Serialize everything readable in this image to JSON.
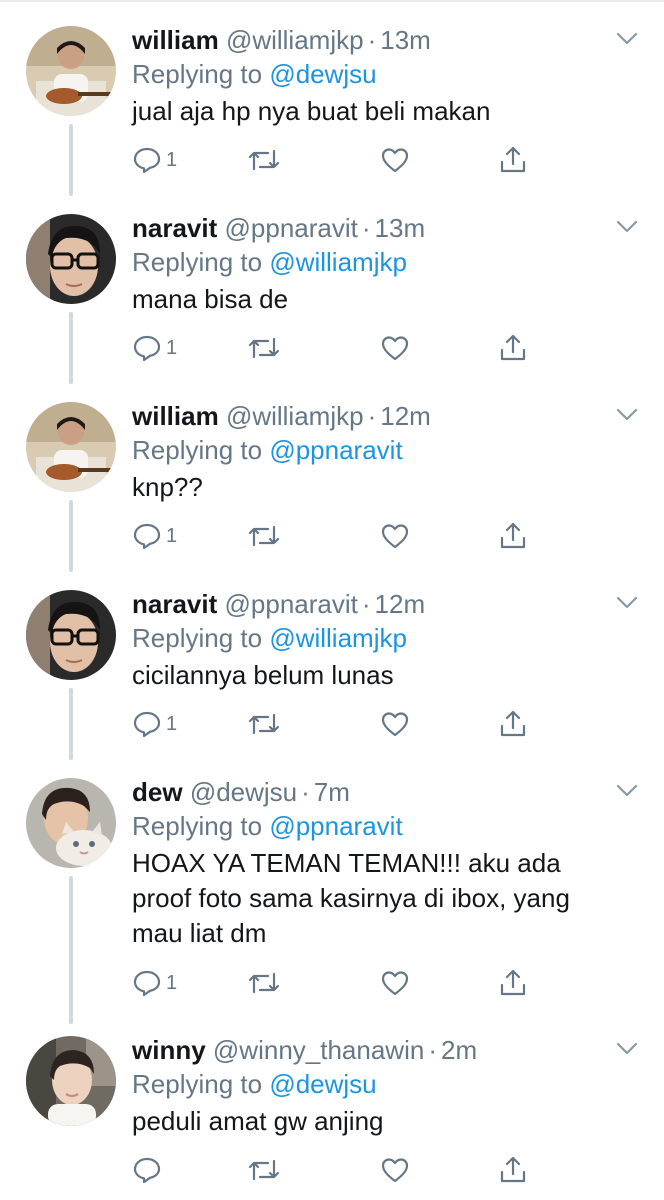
{
  "colors": {
    "text": "#14171a",
    "secondary": "#657786",
    "link": "#1b95e0",
    "thread_line": "#cfd9de"
  },
  "tweets": [
    {
      "name": "william",
      "handle": "@williamjkp",
      "separator": "·",
      "time": "13m",
      "replying_prefix": "Replying to",
      "replying_to": "@dewjsu",
      "text": "jual aja hp nya buat beli makan",
      "reply_count": "1",
      "avatar_icon": "avatar-william"
    },
    {
      "name": "naravit",
      "handle": "@ppnaravit",
      "separator": "·",
      "time": "13m",
      "replying_prefix": "Replying to",
      "replying_to": "@williamjkp",
      "text": "mana bisa de",
      "reply_count": "1",
      "avatar_icon": "avatar-naravit"
    },
    {
      "name": "william",
      "handle": "@williamjkp",
      "separator": "·",
      "time": "12m",
      "replying_prefix": "Replying to",
      "replying_to": "@ppnaravit",
      "text": "knp??",
      "reply_count": "1",
      "avatar_icon": "avatar-william"
    },
    {
      "name": "naravit",
      "handle": "@ppnaravit",
      "separator": "·",
      "time": "12m",
      "replying_prefix": "Replying to",
      "replying_to": "@williamjkp",
      "text": "cicilannya belum lunas",
      "reply_count": "1",
      "avatar_icon": "avatar-naravit"
    },
    {
      "name": "dew",
      "handle": "@dewjsu",
      "separator": "·",
      "time": "7m",
      "replying_prefix": "Replying to",
      "replying_to": "@ppnaravit",
      "text": "HOAX YA TEMAN TEMAN!!! aku ada proof foto sama kasirnya di ibox, yang mau liat dm",
      "reply_count": "1",
      "avatar_icon": "avatar-dew"
    },
    {
      "name": "winny",
      "handle": "@winny_thanawin",
      "separator": "·",
      "time": "2m",
      "replying_prefix": "Replying to",
      "replying_to": "@dewjsu",
      "text": "peduli amat gw anjing",
      "reply_count": "",
      "avatar_icon": "avatar-winny"
    }
  ]
}
